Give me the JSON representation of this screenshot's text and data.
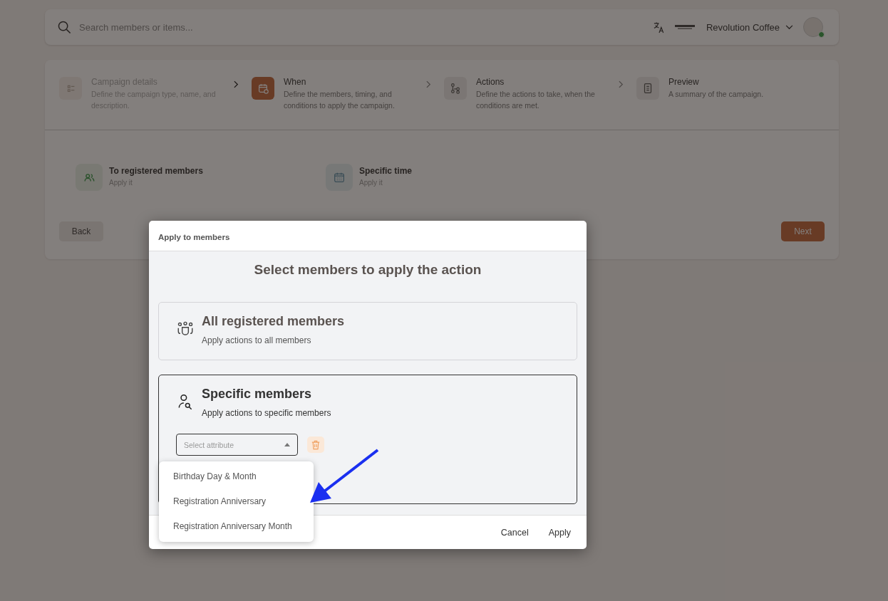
{
  "search": {
    "placeholder": "Search members or items..."
  },
  "account": {
    "name": "Revolution Coffee",
    "online": true
  },
  "steps": [
    {
      "kind": "details",
      "title": "Campaign details",
      "description": "Define the campaign type, name, and description.",
      "selected": false
    },
    {
      "kind": "when",
      "title": "When",
      "description": "Define the members, timing, and conditions to apply the campaign.",
      "selected": true
    },
    {
      "kind": "actions",
      "title": "Actions",
      "description": "Define the actions to take, when the conditions are met.",
      "selected": false
    },
    {
      "kind": "preview",
      "title": "Preview",
      "description": "A summary of the campaign.",
      "selected": false
    }
  ],
  "triggers": [
    {
      "kind": "members",
      "title": "To registered members",
      "subtitle": "Apply it"
    },
    {
      "kind": "time",
      "title": "Specific time",
      "subtitle": "Apply it"
    }
  ],
  "back_button": "Back",
  "next_button": "Next",
  "dialog": {
    "title": "Apply to members",
    "heading": "Select members to apply the action",
    "options": [
      {
        "kind": "all",
        "title": "All registered members",
        "description": "Apply actions to all members",
        "selected": false
      },
      {
        "kind": "specific",
        "title": "Specific members",
        "description": "Apply actions to specific members",
        "selected": true
      }
    ],
    "attribute_select": {
      "placeholder": "Select attribute",
      "expanded": true
    },
    "menu": [
      "Birthday Day & Month",
      "Registration Anniversary",
      "Registration Anniversary Month"
    ],
    "buttons": [
      "Cancel",
      "Apply"
    ]
  }
}
